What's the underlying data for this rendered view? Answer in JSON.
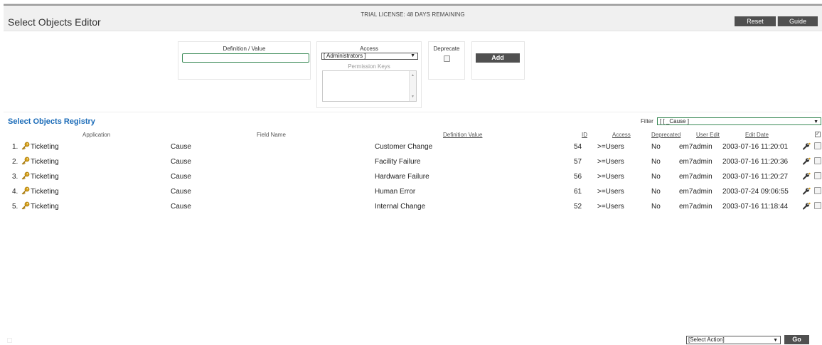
{
  "header": {
    "title": "Select Objects Editor",
    "trial_banner": "TRIAL LICENSE: 48 DAYS REMAINING",
    "reset_label": "Reset",
    "guide_label": "Guide"
  },
  "form": {
    "definition_label": "Definition / Value",
    "definition_value": "",
    "access_label": "Access",
    "access_selected": "[ Administrators ]",
    "permission_keys_label": "Permission Keys",
    "deprecate_label": "Deprecate",
    "add_label": "Add"
  },
  "registry": {
    "title": "Select Objects Registry",
    "filter_label": "Filter",
    "filter_selected": "[ [ _Cause ]",
    "columns": {
      "application": "Application",
      "field_name": "Field Name",
      "definition_value": "Definition Value",
      "id": "ID",
      "access": "Access",
      "deprecated": "Deprecated",
      "user_edit": "User Edit",
      "edit_date": "Edit Date"
    },
    "rows": [
      {
        "num": "1.",
        "application": "Ticketing",
        "field_name": "Cause",
        "definition_value": "Customer Change",
        "id": "54",
        "access": ">=Users",
        "deprecated": "No",
        "user_edit": "em7admin",
        "edit_date": "2003-07-16 11:20:01"
      },
      {
        "num": "2.",
        "application": "Ticketing",
        "field_name": "Cause",
        "definition_value": "Facility Failure",
        "id": "57",
        "access": ">=Users",
        "deprecated": "No",
        "user_edit": "em7admin",
        "edit_date": "2003-07-16 11:20:36"
      },
      {
        "num": "3.",
        "application": "Ticketing",
        "field_name": "Cause",
        "definition_value": "Hardware Failure",
        "id": "56",
        "access": ">=Users",
        "deprecated": "No",
        "user_edit": "em7admin",
        "edit_date": "2003-07-16 11:20:27"
      },
      {
        "num": "4.",
        "application": "Ticketing",
        "field_name": "Cause",
        "definition_value": "Human Error",
        "id": "61",
        "access": ">=Users",
        "deprecated": "No",
        "user_edit": "em7admin",
        "edit_date": "2003-07-24 09:06:55"
      },
      {
        "num": "5.",
        "application": "Ticketing",
        "field_name": "Cause",
        "definition_value": "Internal Change",
        "id": "52",
        "access": ">=Users",
        "deprecated": "No",
        "user_edit": "em7admin",
        "edit_date": "2003-07-16 11:18:44"
      }
    ]
  },
  "footer": {
    "action_selected": "[Select Action]",
    "go_label": "Go"
  },
  "icons": {
    "application": "key-icon",
    "edit": "wrench-icon",
    "dropdown": "triangle-down-icon"
  },
  "colors": {
    "accent_blue": "#1a6bb8",
    "button_dark": "#505050",
    "input_border_green": "#3a8a56",
    "key_gold": "#d9a21b"
  }
}
